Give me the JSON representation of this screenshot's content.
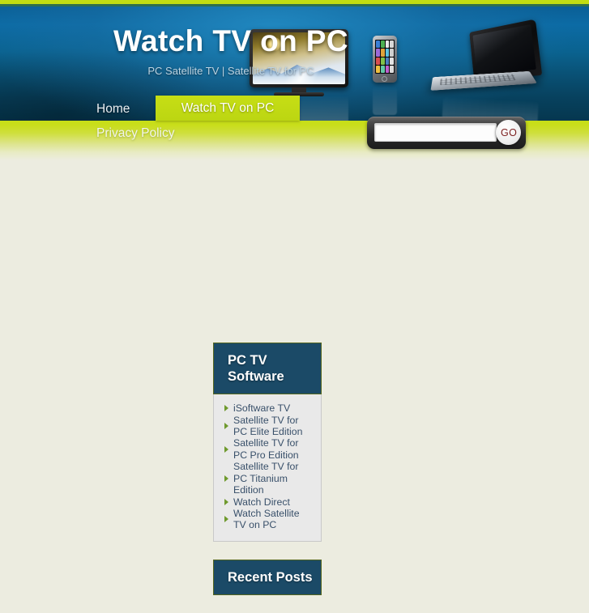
{
  "site": {
    "title": "Watch TV on PC",
    "tagline": "PC Satellite TV | Satellite TV for PC"
  },
  "nav": {
    "home_label": "Home",
    "active_label": "Watch TV on PC",
    "privacy_label": "Privacy Policy"
  },
  "search": {
    "value": "",
    "placeholder": "",
    "go_label": "GO"
  },
  "sidebar": {
    "widgets": [
      {
        "title": "PC TV Software",
        "items": [
          "iSoftware TV",
          "Satellite TV for PC Elite Edition",
          "Satellite TV for PC Pro Edition",
          "Satellite TV for PC Titanium Edition",
          "Watch Direct",
          "Watch Satellite TV on PC"
        ]
      },
      {
        "title": "Recent Posts",
        "items": []
      }
    ]
  },
  "colors": {
    "header_blue": "#0a5f96",
    "header_blue_dark": "#05374f",
    "lime": "#c7de16",
    "body_cream": "#ecece0",
    "widget_head_navy": "#1b4a67",
    "widget_border_olive": "#55661f",
    "widget_body_gray": "#e9e9e9",
    "link_text": "#39506a",
    "arrow_green": "#6f9a2e",
    "go_text_red": "#7b1d1d"
  }
}
